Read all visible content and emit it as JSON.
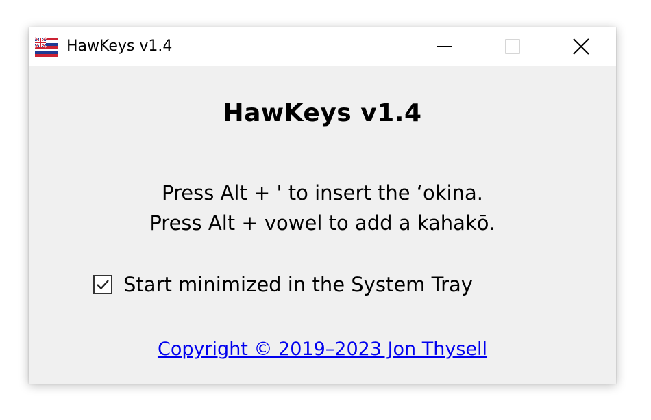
{
  "window": {
    "title": "HawKeys v1.4",
    "app_icon": "hawaii-flag-icon",
    "controls": {
      "minimize_icon": "minimize-icon",
      "maximize_icon": "maximize-icon",
      "close_icon": "close-icon"
    }
  },
  "main": {
    "heading": "HawKeys v1.4",
    "instruction_line1": "Press Alt + ' to insert the ‘okina.",
    "instruction_line2": "Press Alt + vowel to add a kahakō.",
    "start_minimized": {
      "label": "Start minimized in the System Tray",
      "checked": true
    },
    "copyright_link": "Copyright © 2019–2023 Jon Thysell"
  },
  "colors": {
    "window_bg": "#f0f0f0",
    "titlebar_bg": "#ffffff",
    "link": "#0000ee"
  }
}
